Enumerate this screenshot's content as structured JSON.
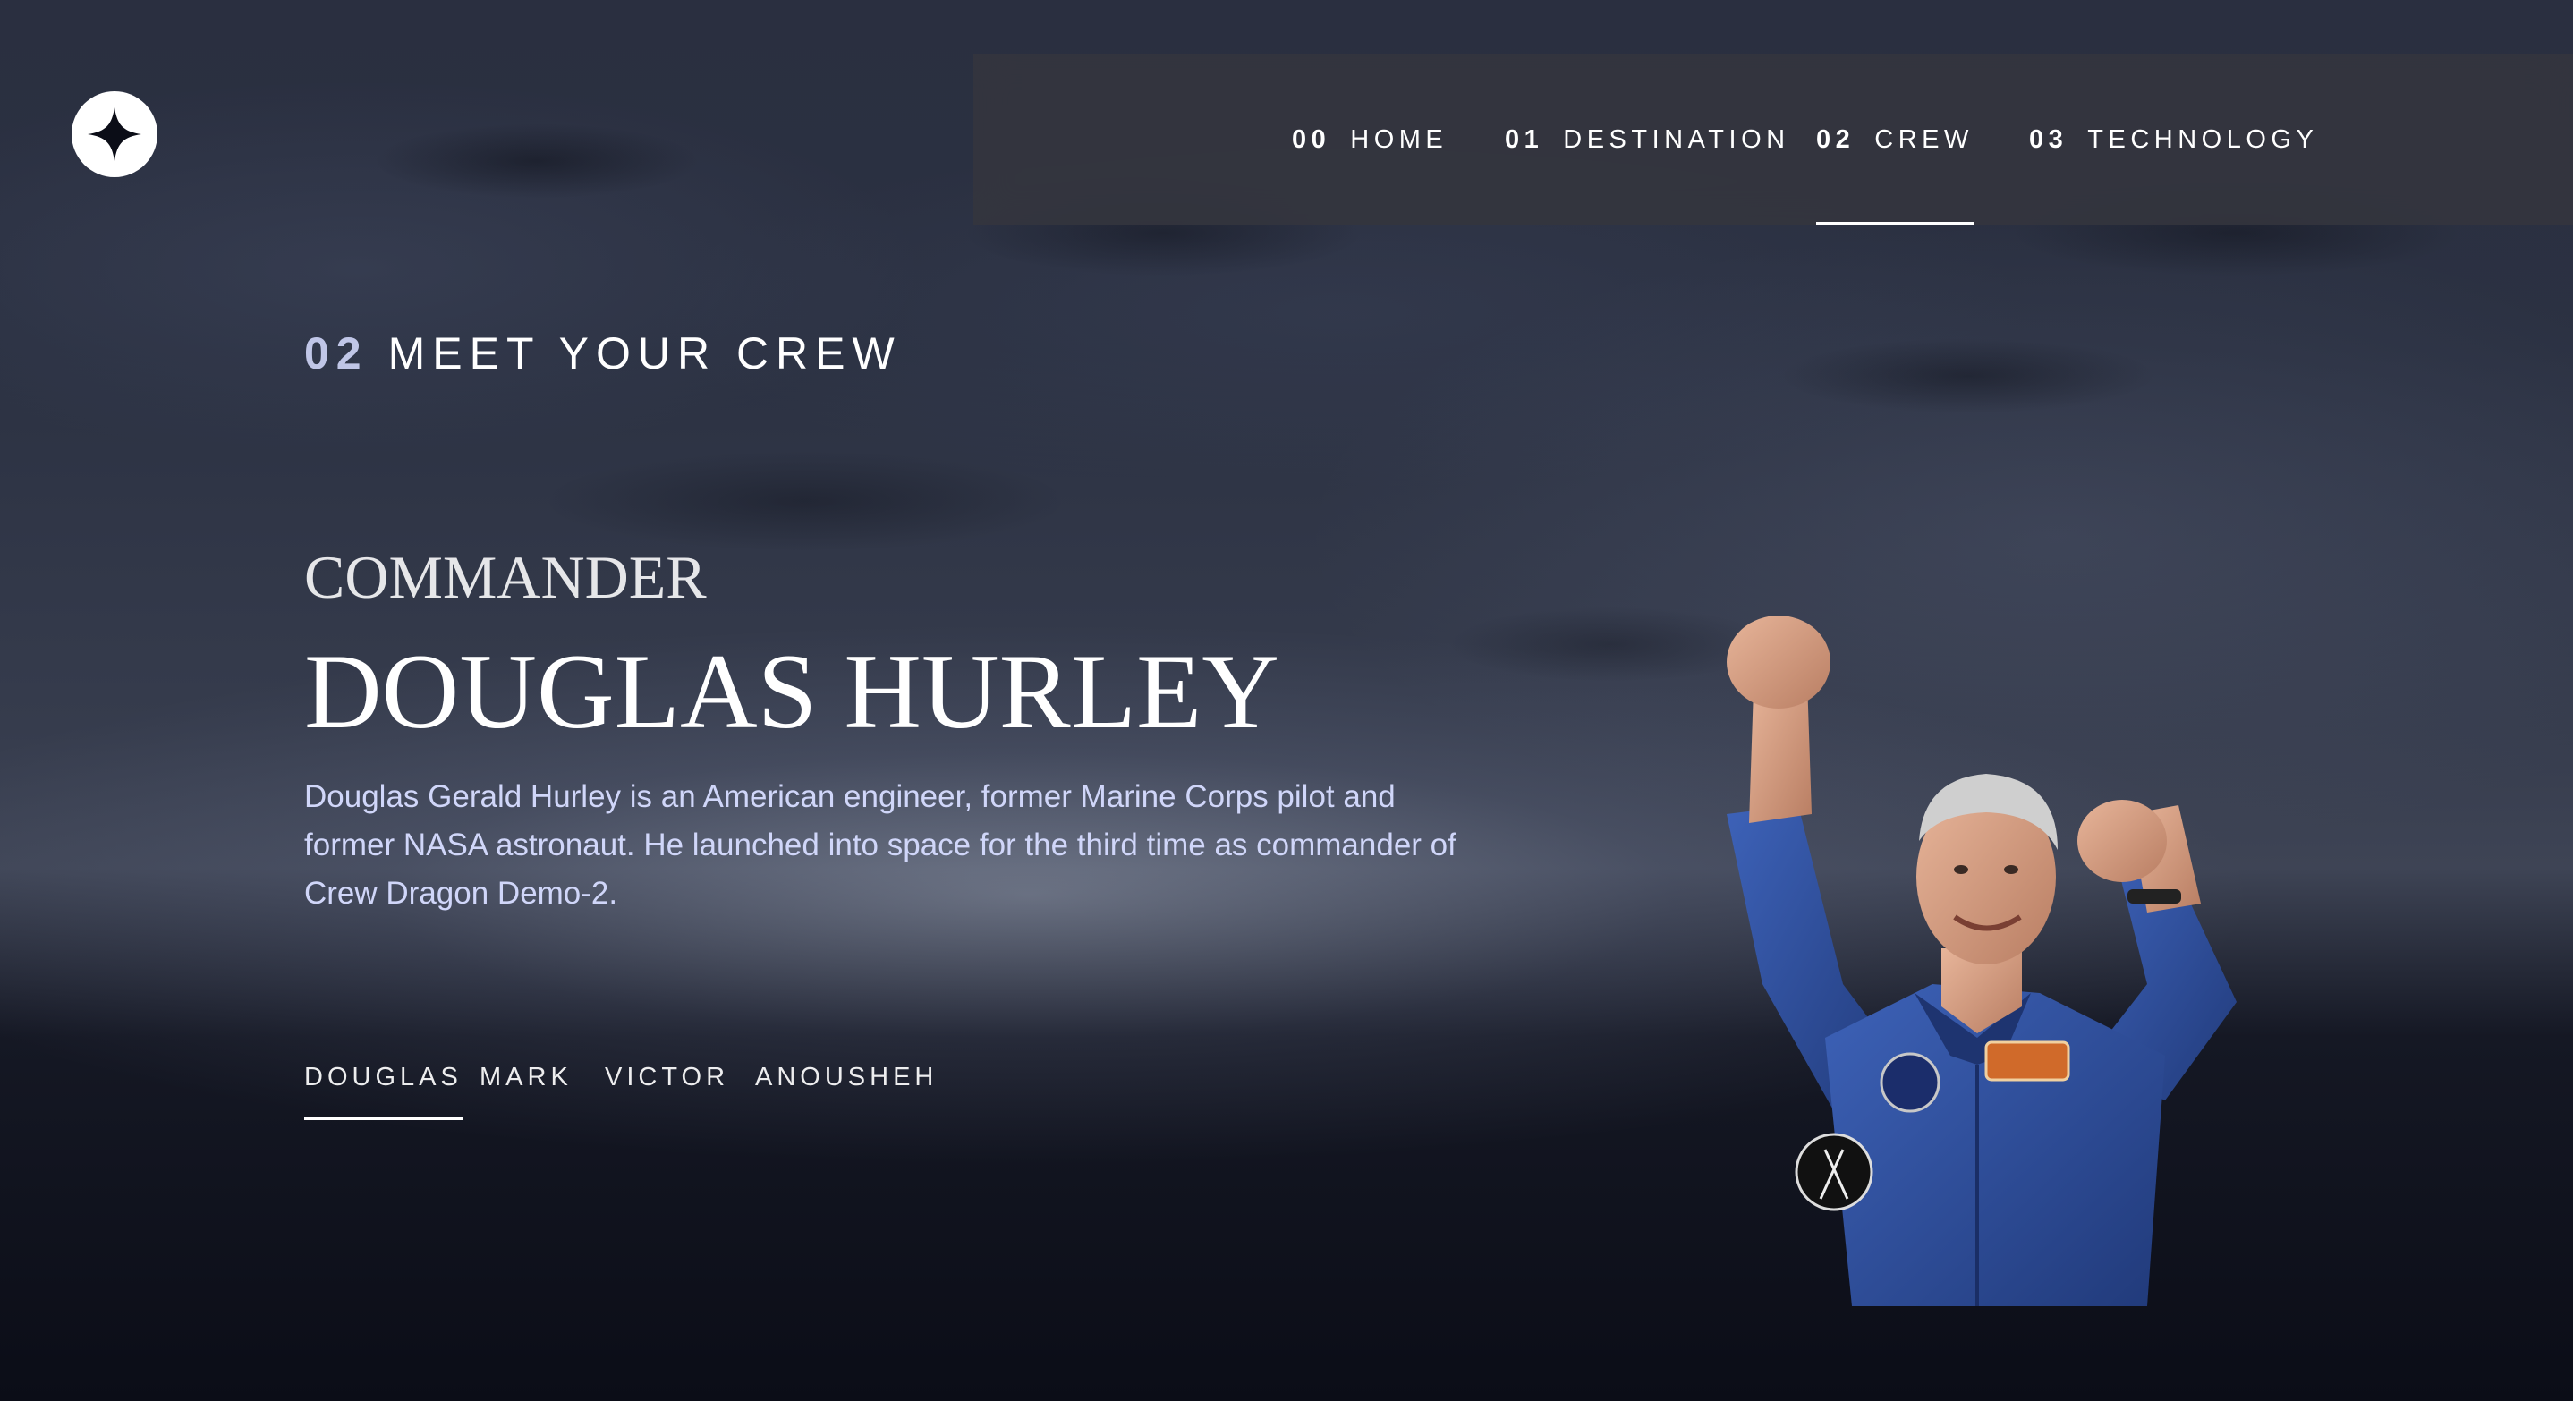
{
  "header": {
    "logo_icon": "star-logo-icon",
    "nav": [
      {
        "num": "00",
        "label": "HOME",
        "active": false
      },
      {
        "num": "01",
        "label": "DESTINATION",
        "active": false
      },
      {
        "num": "02",
        "label": "CREW",
        "active": true
      },
      {
        "num": "03",
        "label": "TECHNOLOGY",
        "active": false
      }
    ]
  },
  "main": {
    "heading_num": "02",
    "heading_text": "MEET YOUR CREW",
    "role": "COMMANDER",
    "name": "DOUGLAS HURLEY",
    "bio": "Douglas Gerald Hurley is an American engineer, former Marine Corps pilot and former NASA astronaut. He launched into space for the third time as commander of Crew Dragon Demo-2.",
    "crew_tabs": [
      {
        "label": "DOUGLAS",
        "active": true
      },
      {
        "label": "MARK",
        "active": false
      },
      {
        "label": "VICTOR",
        "active": false
      },
      {
        "label": "ANOUSHEH",
        "active": false
      }
    ],
    "image_subject": "astronaut-douglas-hurley"
  },
  "colors": {
    "background": "#0b0d17",
    "accent": "#d0d6f9",
    "text": "#ffffff",
    "suit": "#2f4f9a"
  }
}
